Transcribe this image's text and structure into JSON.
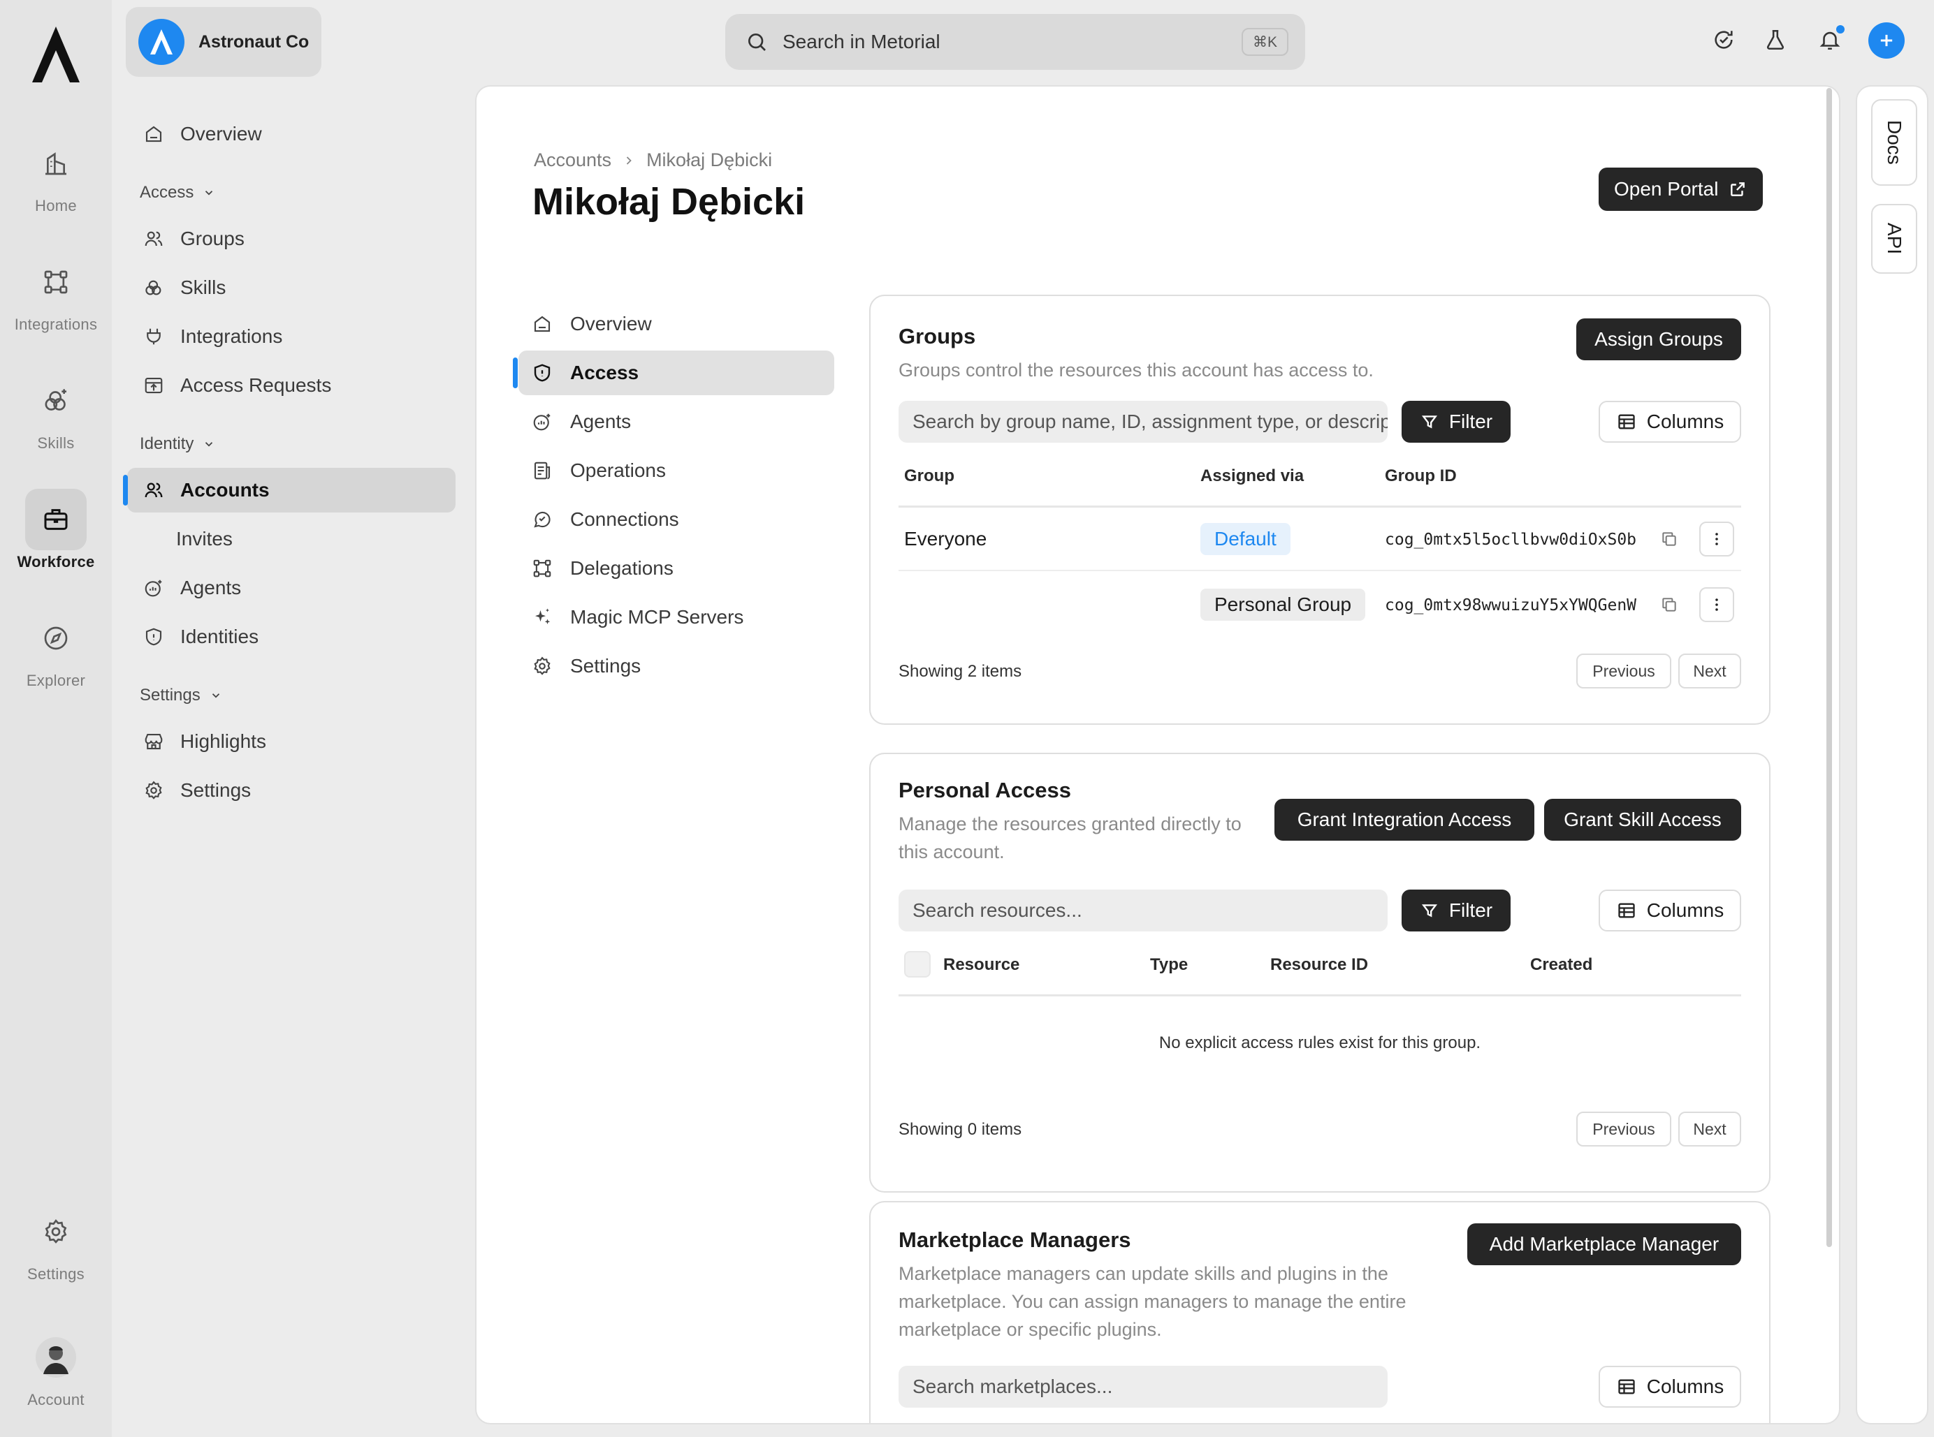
{
  "rail": {
    "items": [
      {
        "label": "Home",
        "icon": "home-icon"
      },
      {
        "label": "Integrations",
        "icon": "integrations-icon"
      },
      {
        "label": "Skills",
        "icon": "skills-icon"
      },
      {
        "label": "Workforce",
        "icon": "workforce-icon",
        "active": true
      },
      {
        "label": "Explorer",
        "icon": "compass-icon"
      }
    ],
    "settings_label": "Settings",
    "account_label": "Account"
  },
  "org": {
    "name": "Astronaut Co"
  },
  "sidebar": {
    "overview": "Overview",
    "sections": {
      "access": "Access",
      "identity": "Identity",
      "settings": "Settings"
    },
    "access_items": [
      "Groups",
      "Skills",
      "Integrations",
      "Access Requests"
    ],
    "identity_items": [
      "Accounts",
      "Invites",
      "Agents",
      "Identities"
    ],
    "settings_items": [
      "Highlights",
      "Settings"
    ],
    "active": "Accounts"
  },
  "search": {
    "placeholder": "Search in Metorial",
    "shortcut": "⌘K"
  },
  "colors": {
    "accent": "#1e88f0",
    "dark_button": "#262626"
  },
  "page": {
    "breadcrumb": [
      "Accounts",
      "Mikołaj Dębicki"
    ],
    "title": "Mikołaj Dębicki",
    "open_portal": "Open Portal"
  },
  "subnav": {
    "items": [
      "Overview",
      "Access",
      "Agents",
      "Operations",
      "Connections",
      "Delegations",
      "Magic MCP Servers",
      "Settings"
    ],
    "active": "Access"
  },
  "groups_card": {
    "title": "Groups",
    "description": "Groups control the resources this account has access to.",
    "assign_button": "Assign Groups",
    "search_placeholder": "Search by group name, ID, assignment type, or description...",
    "filter_label": "Filter",
    "columns_label": "Columns",
    "headers": [
      "Group",
      "Assigned via",
      "Group ID"
    ],
    "rows": [
      {
        "group": "Everyone",
        "assigned_via": "Default",
        "group_id": "cog_0mtx5l5ocllbvw0diOxS0b"
      },
      {
        "group": "",
        "assigned_via": "Personal Group",
        "group_id": "cog_0mtx98wwuizuY5xYWQGenW"
      }
    ],
    "showing": "Showing 2 items",
    "previous": "Previous",
    "next": "Next"
  },
  "personal_card": {
    "title": "Personal Access",
    "description": "Manage the resources granted directly to this account.",
    "grant_integration": "Grant Integration Access",
    "grant_skill": "Grant Skill Access",
    "search_placeholder": "Search resources...",
    "filter_label": "Filter",
    "columns_label": "Columns",
    "headers": [
      "Resource",
      "Type",
      "Resource ID",
      "Created"
    ],
    "empty": "No explicit access rules exist for this group.",
    "showing": "Showing 0 items",
    "previous": "Previous",
    "next": "Next"
  },
  "marketplace_card": {
    "title": "Marketplace Managers",
    "description": "Marketplace managers can update skills and plugins in the marketplace. You can assign managers to manage the entire marketplace or specific plugins.",
    "add_button": "Add Marketplace Manager",
    "search_placeholder": "Search marketplaces...",
    "columns_label": "Columns"
  },
  "docrail": {
    "docs": "Docs",
    "api": "API"
  }
}
